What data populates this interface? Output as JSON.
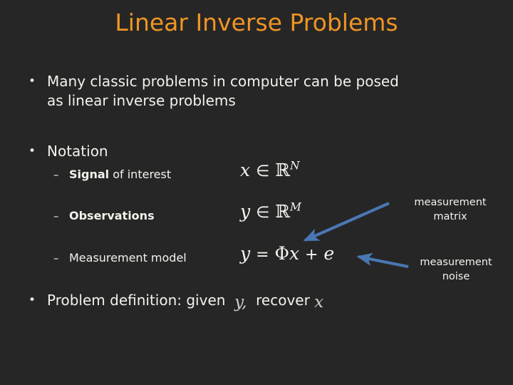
{
  "slide": {
    "title": "Linear Inverse Problems",
    "background_color": "#262626",
    "title_color": "#ef9524",
    "body_text_color": "#f2f2ec",
    "arrow_color": "#4a77b4"
  },
  "bullets": {
    "b1": {
      "marker": "•",
      "line1": "Many classic problems in computer can be posed",
      "line2": "as linear inverse problems"
    },
    "b2": {
      "marker": "•",
      "text": "Notation"
    },
    "b3": {
      "marker": "•",
      "text_before": "Problem definition: given",
      "math_given": "y,",
      "text_middle": "recover",
      "math_recover": "x"
    }
  },
  "sub_bullets": [
    {
      "marker": "–",
      "bold_part": "Signal",
      "rest": " of interest",
      "formula": {
        "lhs": "x",
        "op": "∈",
        "set": "ℝ",
        "exponent": "N"
      }
    },
    {
      "marker": "–",
      "bold_part": "Observations",
      "rest": "",
      "formula": {
        "lhs": "y",
        "op": "∈",
        "set": "ℝ",
        "exponent": "M"
      }
    },
    {
      "marker": "–",
      "bold_part": "",
      "rest": "Measurement model",
      "formula": {
        "lhs": "y",
        "op": "=",
        "phi": "Φ",
        "var": "x",
        "plus": "+",
        "noise": "e"
      }
    }
  ],
  "callouts": [
    {
      "line1": "measurement",
      "line2": "matrix",
      "target": "phi"
    },
    {
      "line1": "measurement",
      "line2": "noise",
      "target": "e"
    }
  ]
}
